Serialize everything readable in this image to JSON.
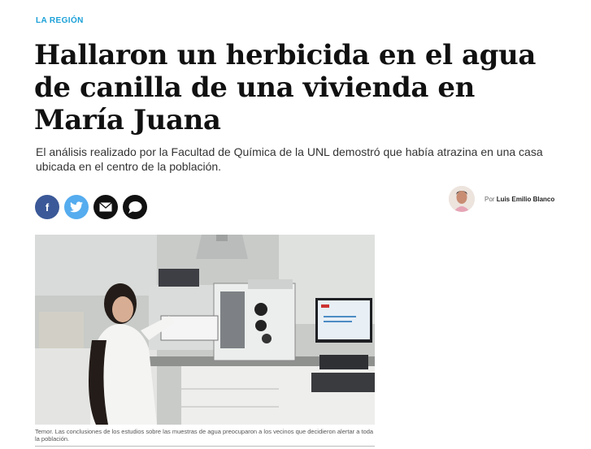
{
  "article": {
    "section": "LA REGIÓN",
    "headline": "Hallaron un herbicida en el agua de canilla de una vivienda en María Juana",
    "subtitle": "El análisis realizado por la Facultad de Química de la UNL demostró que había atrazina en una casa ubicada en el centro de la población.",
    "byline_prefix": "Por",
    "author_name": "Luis Emilio Blanco",
    "photo_caption": "Temor. Las conclusiones de los estudios sobre las muestras de agua preocuparon a los vecinos que decidieron alertar a toda la población."
  },
  "share": [
    {
      "icon": "facebook-icon",
      "color": "#3b5998"
    },
    {
      "icon": "twitter-icon",
      "color": "#55acee"
    },
    {
      "icon": "email-icon",
      "color": "#111111"
    },
    {
      "icon": "comment-icon",
      "color": "#111111"
    }
  ],
  "colors": {
    "section": "#1aa0d8"
  }
}
